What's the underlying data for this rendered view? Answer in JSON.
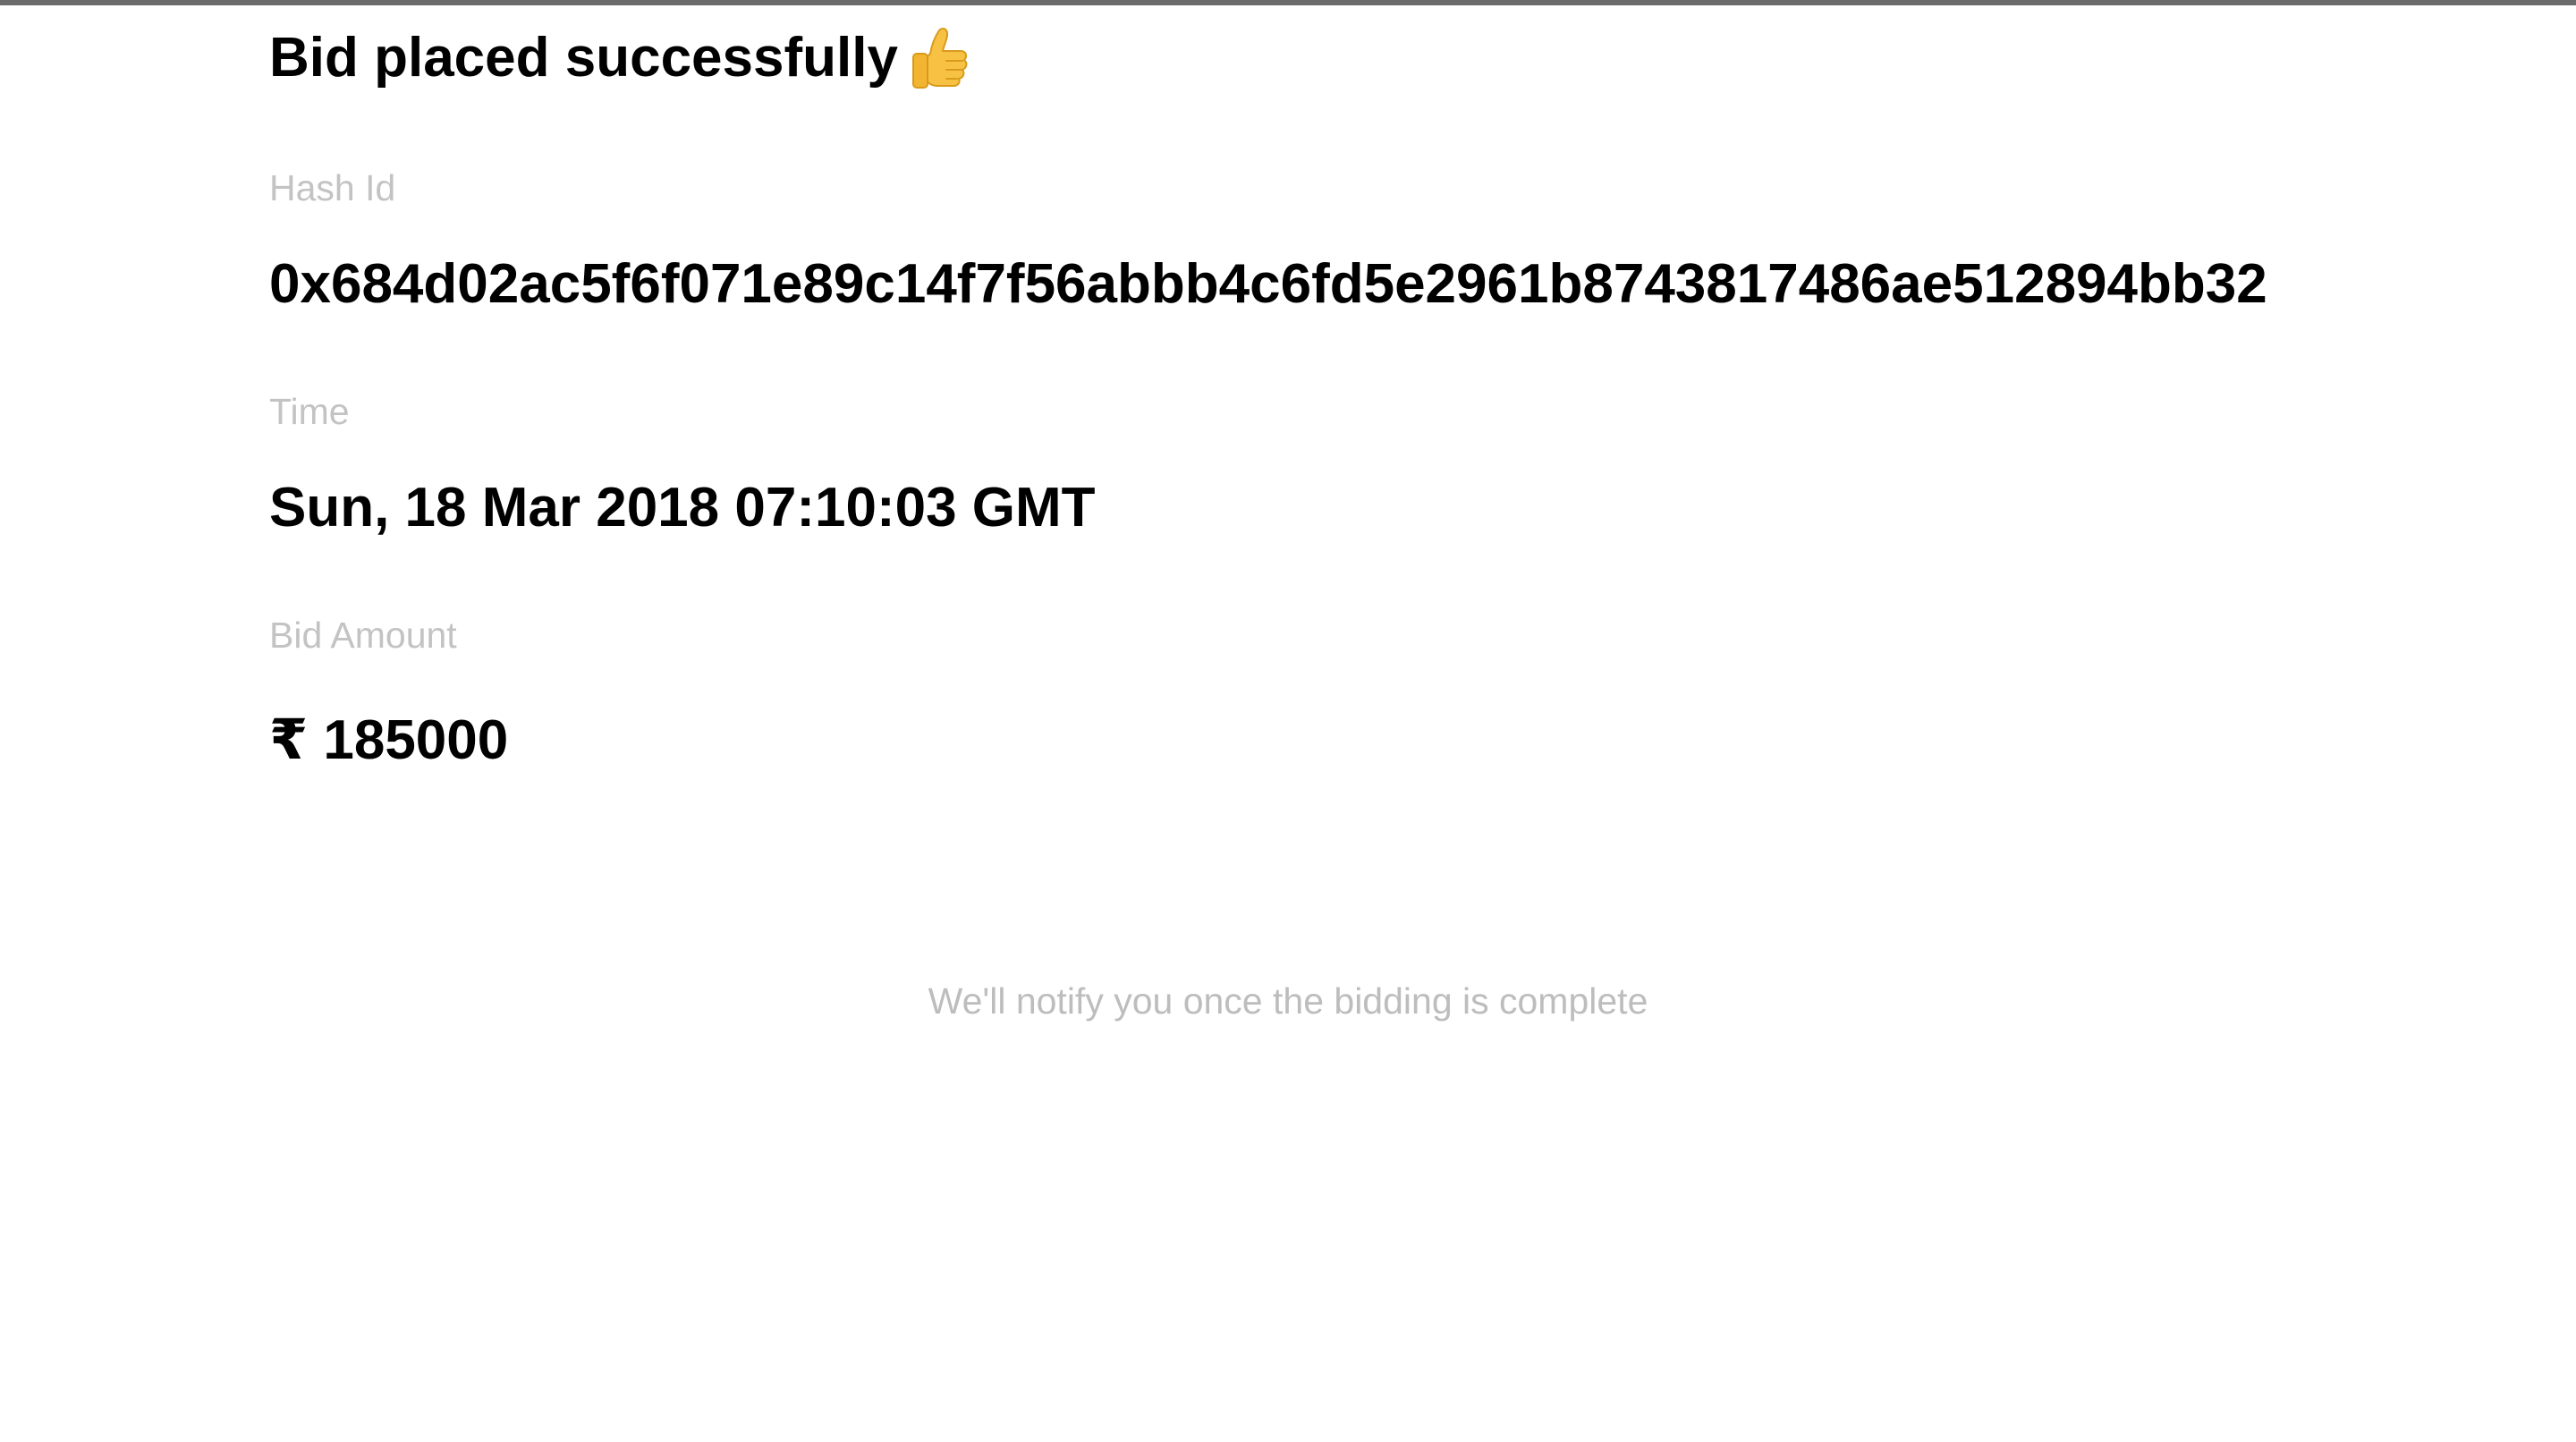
{
  "header": {
    "title": "Bid placed successfully",
    "title_icon": "thumbs-up-icon"
  },
  "details": {
    "hash_label": "Hash Id",
    "hash_value": "0x684d02ac5f6f071e89c14f7f56abbb4c6fd5e2961b8743817486ae512894bb32",
    "time_label": "Time",
    "time_value": "Sun, 18 Mar 2018 07:10:03 GMT",
    "amount_label": "Bid Amount",
    "amount_value": "₹ 185000"
  },
  "footer": {
    "note": "We'll notify you once the bidding is complete"
  },
  "colors": {
    "top_border": "#6b6b6b",
    "label_text": "#c3c3c3",
    "value_text": "#000000",
    "note_text": "#bdbdbd",
    "thumb_icon": "#f5c242"
  }
}
